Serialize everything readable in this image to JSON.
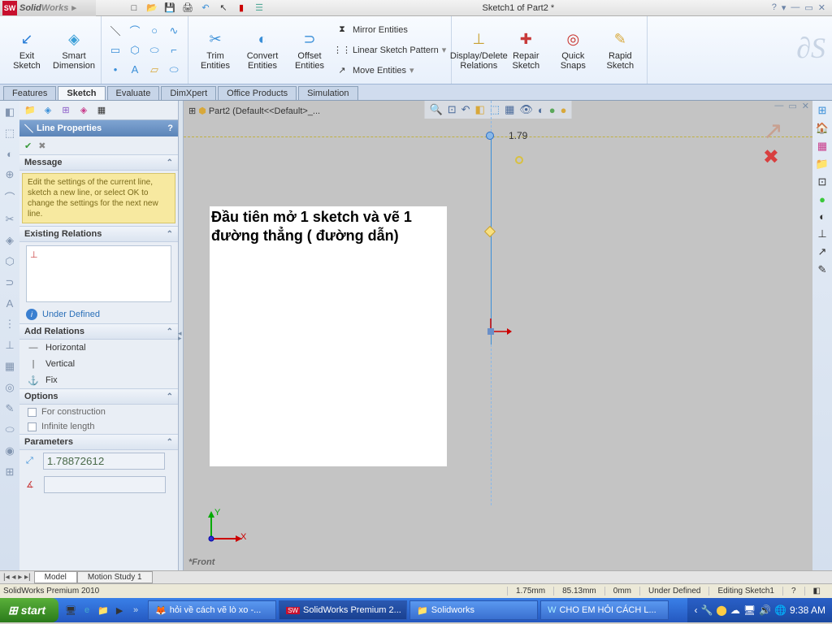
{
  "title": "Sketch1 of Part2 *",
  "logo": {
    "sw": "SW",
    "solid": "Solid",
    "works": "Works"
  },
  "ribbon": {
    "exit_sketch": "Exit\nSketch",
    "smart_dimension": "Smart\nDimension",
    "trim": "Trim\nEntities",
    "convert": "Convert\nEntities",
    "offset": "Offset\nEntities",
    "mirror": "Mirror Entities",
    "linear_pattern": "Linear Sketch Pattern",
    "move": "Move Entities",
    "display_delete": "Display/Delete\nRelations",
    "repair": "Repair\nSketch",
    "quick_snaps": "Quick\nSnaps",
    "rapid": "Rapid\nSketch"
  },
  "tabs": [
    "Features",
    "Sketch",
    "Evaluate",
    "DimXpert",
    "Office Products",
    "Simulation"
  ],
  "active_tab": "Sketch",
  "tree_label": "Part2  (Default<<Default>_...",
  "panel": {
    "title": "Line Properties",
    "message_hd": "Message",
    "message": "Edit the settings of the current line, sketch a new line, or select OK to change the settings for the next new line.",
    "existing": "Existing Relations",
    "under_defined": "Under Defined",
    "add_relations": "Add Relations",
    "horizontal": "Horizontal",
    "vertical": "Vertical",
    "fix": "Fix",
    "options": "Options",
    "for_construction": "For construction",
    "infinite": "Infinite length",
    "parameters": "Parameters",
    "param1": "1.78872612"
  },
  "note_line1": "Đầu tiên mở 1 sketch và vẽ 1",
  "note_line2": "đường thẳng ( đường dẫn)",
  "dimension": "1.79",
  "view_label": "*Front",
  "y_label": "Y",
  "x_label": "X",
  "bottom_tabs": {
    "model": "Model",
    "motion": "Motion Study 1"
  },
  "status": {
    "product": "SolidWorks Premium 2010",
    "d1": "1.75mm",
    "d2": "85.13mm",
    "d3": "0mm",
    "state": "Under Defined",
    "editing": "Editing Sketch1"
  },
  "taskbar": {
    "start": "start",
    "t1": "hỏi về cách vẽ lò xo -...",
    "t2": "SolidWorks Premium 2...",
    "t3": "Solidworks",
    "t4": "CHO EM HỎI CÁCH L...",
    "time": "9:38 AM"
  }
}
